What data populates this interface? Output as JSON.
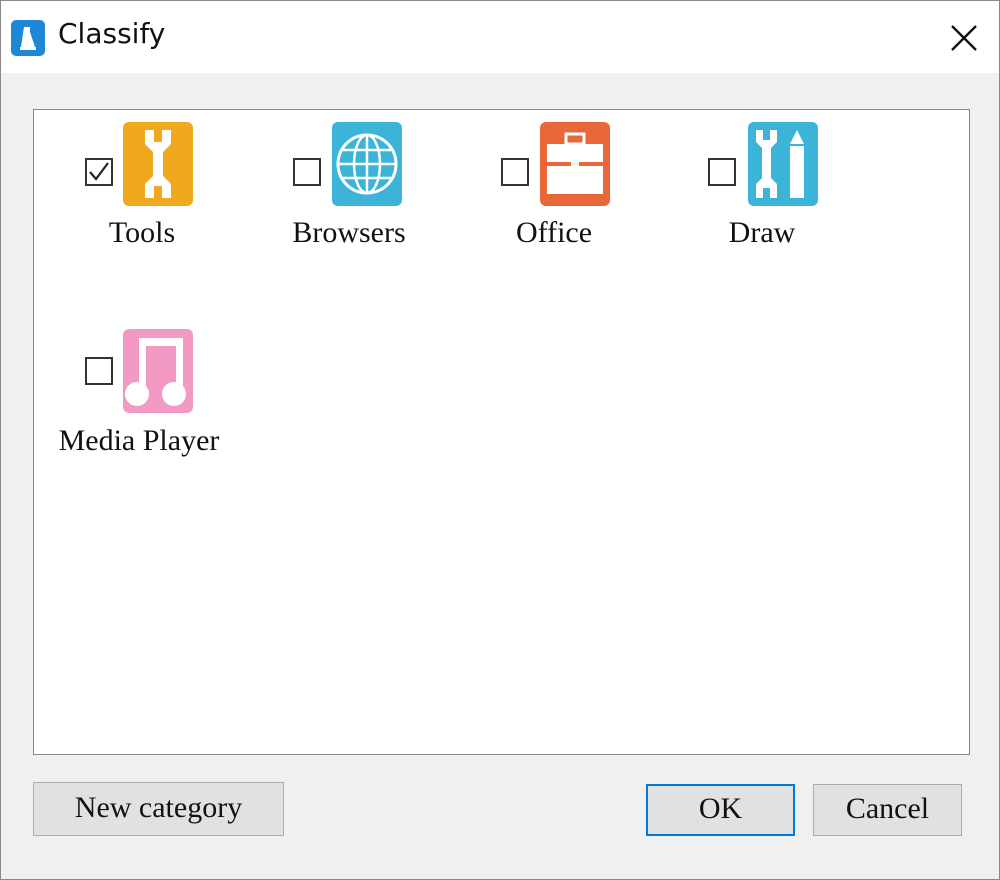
{
  "window": {
    "title": "Classify"
  },
  "categories": [
    {
      "label": "Tools",
      "checked": true,
      "icon": "tools-icon",
      "color": "#f0a81e"
    },
    {
      "label": "Browsers",
      "checked": false,
      "icon": "globe-icon",
      "color": "#3cb4d8"
    },
    {
      "label": "Office",
      "checked": false,
      "icon": "briefcase-icon",
      "color": "#e8683a"
    },
    {
      "label": "Draw",
      "checked": false,
      "icon": "wrench-pencil-icon",
      "color": "#3cb4d8"
    },
    {
      "label": "Media Player",
      "checked": false,
      "icon": "music-note-icon",
      "color": "#f29ac4"
    }
  ],
  "buttons": {
    "new_category": "New category",
    "ok": "OK",
    "cancel": "Cancel"
  },
  "colors": {
    "accent": "#0078d7",
    "app_icon": "#1e88d6"
  }
}
